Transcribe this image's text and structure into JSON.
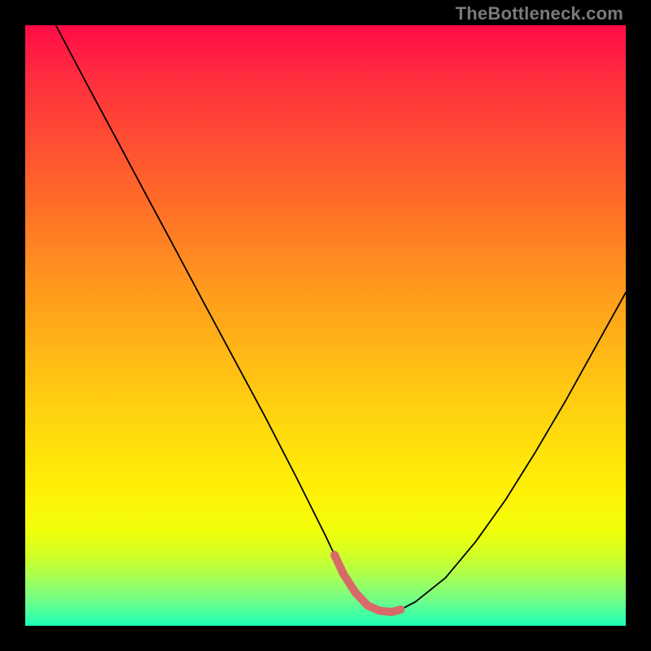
{
  "watermark": "TheBottleneck.com",
  "colors": {
    "page_bg": "#000000",
    "curve_stroke": "#000000",
    "spline_stroke": "#d96a6a",
    "gradient_top": "#ff0b46",
    "gradient_bottom": "#1cffb5"
  },
  "chart_data": {
    "type": "line",
    "title": "",
    "xlabel": "",
    "ylabel": "",
    "xlim": [
      0,
      100
    ],
    "ylim": [
      0,
      100
    ],
    "grid": false,
    "legend": false,
    "series": [
      {
        "name": "bottleneck-curve",
        "x": [
          5.1,
          10,
          15,
          20,
          25,
          30,
          35,
          40,
          45,
          50,
          51.5,
          53,
          55,
          57,
          59,
          61,
          62.5,
          65,
          70,
          75,
          80,
          85,
          90,
          95,
          100
        ],
        "values": [
          100,
          90.7,
          81.4,
          72,
          62.7,
          53.3,
          44,
          34.7,
          25,
          15,
          11.8,
          8.6,
          5.5,
          3.4,
          2.5,
          2.3,
          2.7,
          4.0,
          8.0,
          14,
          21,
          29,
          37.5,
          46.5,
          55.5
        ]
      }
    ],
    "highlight_spline": {
      "name": "valley-spline",
      "x": [
        51.5,
        53,
        55,
        57,
        59,
        61,
        62.5
      ],
      "values": [
        11.8,
        8.6,
        5.5,
        3.4,
        2.5,
        2.3,
        2.7
      ],
      "stroke": "#d96a6a",
      "dot_radius_px": 5,
      "stroke_width_px": 10
    }
  }
}
